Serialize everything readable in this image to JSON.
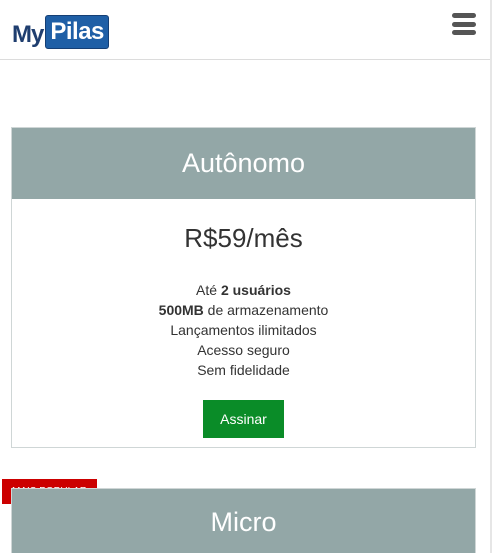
{
  "header": {
    "logo_my": "My",
    "logo_pilas": "Pilas",
    "menu_icon": "hamburger-menu-icon"
  },
  "plans": [
    {
      "name": "Autônomo",
      "price": "R$59/mês",
      "features": [
        {
          "prefix": "Até ",
          "bold": "2 usuários",
          "suffix": ""
        },
        {
          "prefix": "",
          "bold": "500MB",
          "suffix": " de armazenamento"
        },
        {
          "prefix": "Lançamentos ilimitados",
          "bold": "",
          "suffix": ""
        },
        {
          "prefix": "Acesso seguro",
          "bold": "",
          "suffix": ""
        },
        {
          "prefix": "Sem fidelidade",
          "bold": "",
          "suffix": ""
        }
      ],
      "cta": "Assinar"
    },
    {
      "name": "Micro",
      "badge": "Mais Popular"
    }
  ],
  "colors": {
    "card_header": "#93a7a7",
    "cta": "#0a8c28",
    "badge": "#cc0000",
    "logo": "#1f5fa6"
  }
}
